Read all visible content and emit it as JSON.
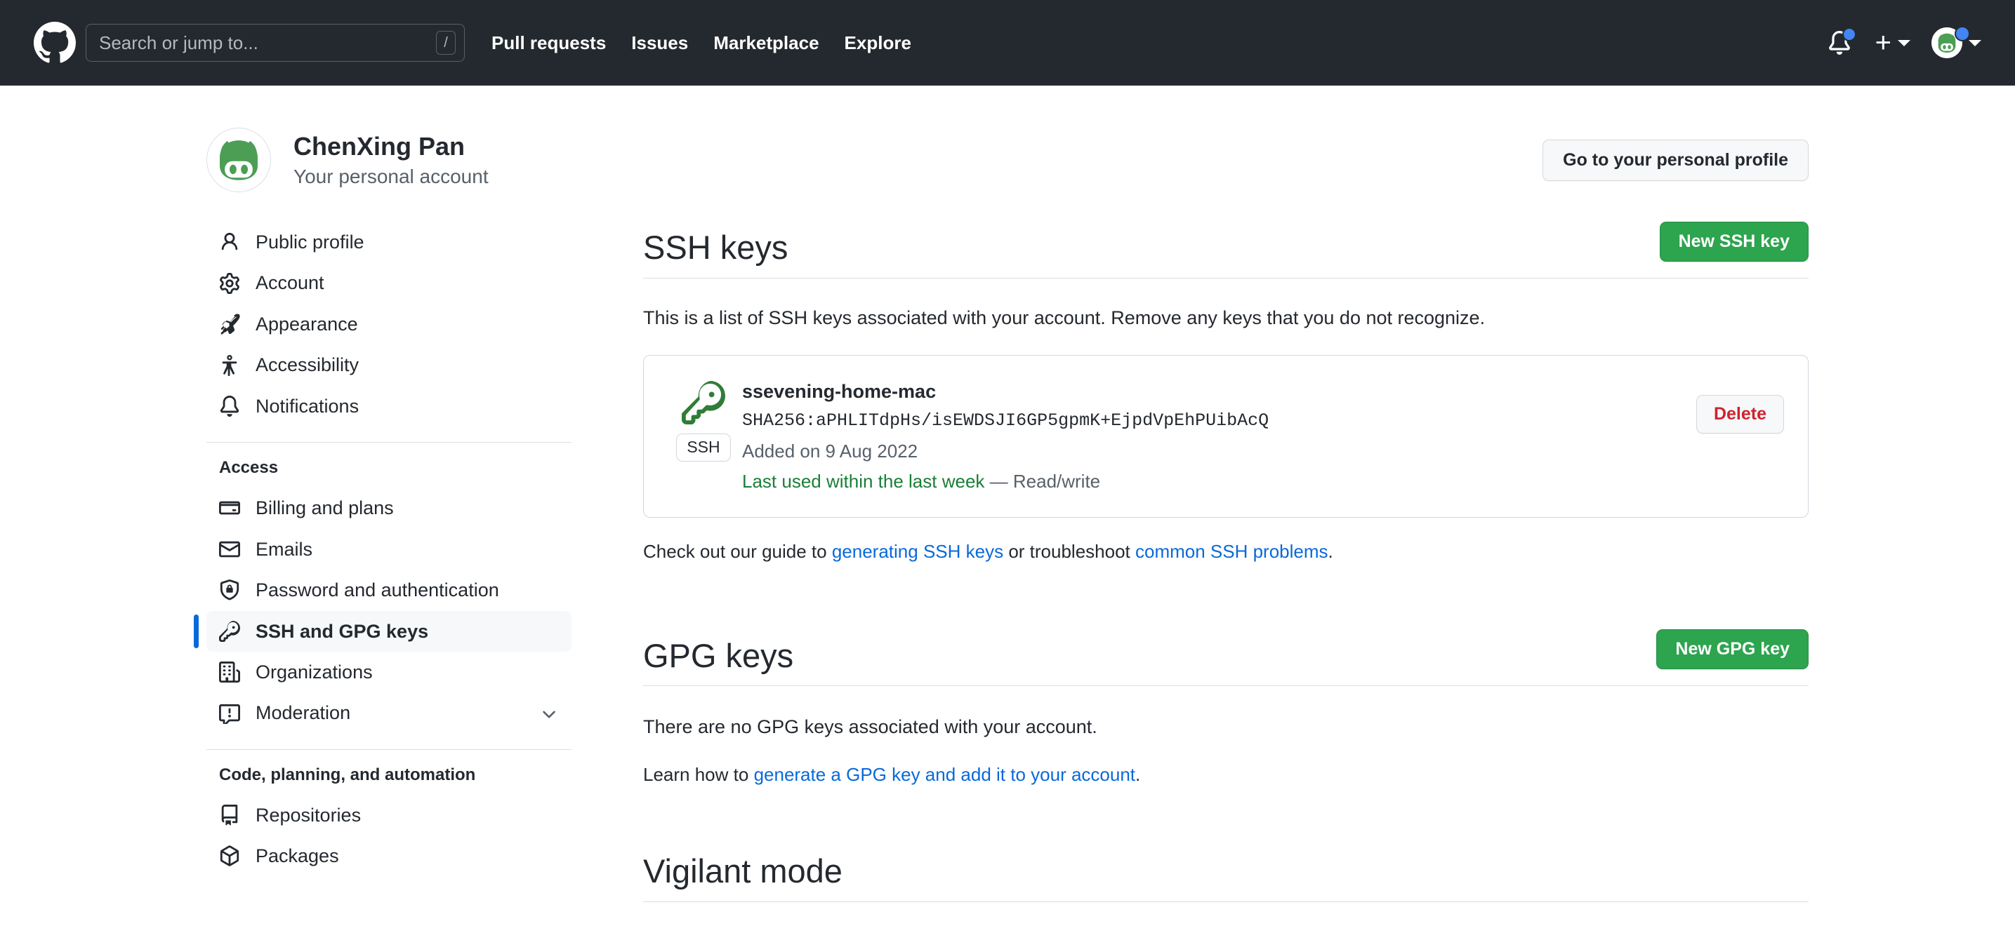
{
  "header": {
    "logo_icon": "github-mark-icon",
    "search": {
      "placeholder": "Search or jump to...",
      "value": "",
      "shortcut_key": "/"
    },
    "nav": [
      {
        "label": "Pull requests",
        "name": "nav-pull-requests"
      },
      {
        "label": "Issues",
        "name": "nav-issues"
      },
      {
        "label": "Marketplace",
        "name": "nav-marketplace"
      },
      {
        "label": "Explore",
        "name": "nav-explore"
      }
    ],
    "notifications_icon": "bell-icon",
    "notifications_has_unread": true,
    "create_new_icon": "plus-icon",
    "profile_icon": "avatar-icon",
    "profile_has_badge": true
  },
  "account": {
    "name": "ChenXing Pan",
    "subtitle": "Your personal account",
    "profile_button_label": "Go to your personal profile",
    "avatar_icon": "octocat-avatar-icon"
  },
  "sidebar": {
    "primary_items": [
      {
        "label": "Public profile",
        "icon": "person-icon",
        "selected": false
      },
      {
        "label": "Account",
        "icon": "gear-icon",
        "selected": false
      },
      {
        "label": "Appearance",
        "icon": "paintbrush-icon",
        "selected": false
      },
      {
        "label": "Accessibility",
        "icon": "accessibility-icon",
        "selected": false
      },
      {
        "label": "Notifications",
        "icon": "bell-icon",
        "selected": false
      }
    ],
    "access_group_title": "Access",
    "access_items": [
      {
        "label": "Billing and plans",
        "icon": "credit-card-icon",
        "selected": false,
        "chevron": false
      },
      {
        "label": "Emails",
        "icon": "mail-icon",
        "selected": false,
        "chevron": false
      },
      {
        "label": "Password and authentication",
        "icon": "shield-lock-icon",
        "selected": false,
        "chevron": false
      },
      {
        "label": "SSH and GPG keys",
        "icon": "key-icon",
        "selected": true,
        "chevron": false
      },
      {
        "label": "Organizations",
        "icon": "organization-icon",
        "selected": false,
        "chevron": false
      },
      {
        "label": "Moderation",
        "icon": "report-icon",
        "selected": false,
        "chevron": true
      }
    ],
    "code_group_title": "Code, planning, and automation",
    "code_items": [
      {
        "label": "Repositories",
        "icon": "repo-icon",
        "selected": false,
        "chevron": false
      },
      {
        "label": "Packages",
        "icon": "package-icon",
        "selected": false,
        "chevron": false
      }
    ]
  },
  "ssh_section": {
    "title": "SSH keys",
    "new_button_label": "New SSH key",
    "description": "This is a list of SSH keys associated with your account. Remove any keys that you do not recognize.",
    "keys": [
      {
        "title": "ssevening-home-mac",
        "fingerprint": "SHA256:aPHLITdpHs/isEWDSJI6GP5gpmK+EjpdVpEhPUibAcQ",
        "added": "Added on 9 Aug 2022",
        "last_used": "Last used within the last week",
        "access": " — Read/write",
        "badge": "SSH",
        "delete_label": "Delete",
        "key_icon": "key-icon"
      }
    ],
    "guide_prefix": "Check out our guide to ",
    "guide_link_1": "generating SSH keys",
    "guide_middle": " or troubleshoot ",
    "guide_link_2": "common SSH problems",
    "guide_suffix": "."
  },
  "gpg_section": {
    "title": "GPG keys",
    "new_button_label": "New GPG key",
    "empty_text": "There are no GPG keys associated with your account.",
    "learn_prefix": "Learn how to ",
    "learn_link": "generate a GPG key and add it to your account",
    "learn_suffix": "."
  },
  "vigilant_section": {
    "title": "Vigilant mode"
  },
  "colors": {
    "header_bg": "#24292f",
    "accent_green": "#2da44e",
    "link_blue": "#0969da",
    "selected_bar": "#0969da",
    "danger_red": "#cf222e",
    "success_green": "#1a7f37",
    "notification_dot": "#4285f4"
  }
}
